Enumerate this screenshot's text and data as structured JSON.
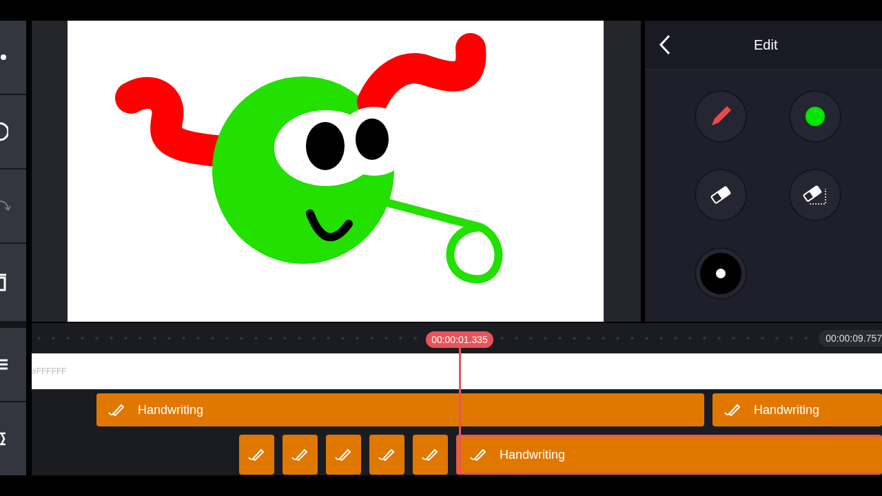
{
  "panel": {
    "title": "Edit",
    "tools": [
      {
        "kind": "pen"
      },
      {
        "kind": "color",
        "color": "#00e600"
      },
      {
        "kind": "eraser"
      },
      {
        "kind": "eraser-area"
      },
      {
        "kind": "brush-size"
      }
    ]
  },
  "timeline": {
    "playhead_time": "00:00:01.335",
    "end_time": "00:00:09.757",
    "tracks": [
      {
        "kind": "color",
        "label": "#FFFFFF"
      },
      {
        "kind": "clips",
        "clips": [
          {
            "kind": "labeled",
            "label": "Handwriting",
            "selected": false
          },
          {
            "kind": "labeled",
            "label": "Handwriting",
            "selected": false
          }
        ]
      },
      {
        "kind": "clips",
        "clips": [
          {
            "kind": "icon",
            "selected": false
          },
          {
            "kind": "icon",
            "selected": false
          },
          {
            "kind": "icon",
            "selected": false
          },
          {
            "kind": "icon",
            "selected": false
          },
          {
            "kind": "icon",
            "selected": false
          },
          {
            "kind": "labeled",
            "label": "Handwriting",
            "selected": true
          }
        ]
      }
    ]
  }
}
